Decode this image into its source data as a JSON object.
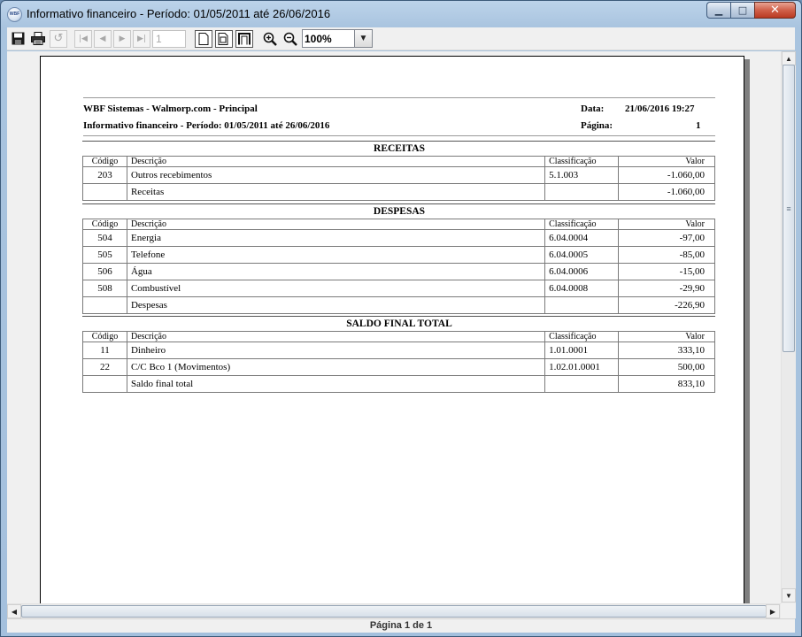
{
  "window": {
    "title": "Informativo financeiro - Período: 01/05/2011 até 26/06/2016",
    "app_icon_text": "WBF"
  },
  "toolbar": {
    "page_input": "1",
    "zoom": "100%",
    "icons": [
      "save-icon",
      "print-icon",
      "refresh-icon",
      "first-page-icon",
      "prev-page-icon",
      "next-page-icon",
      "last-page-icon",
      "single-page-icon",
      "multi-page-icon",
      "page-width-icon",
      "zoom-in-icon",
      "zoom-out-icon"
    ]
  },
  "report": {
    "company": "WBF Sistemas - Walmorp.com - Principal",
    "subtitle": "Informativo financeiro - Período: 01/05/2011 até 26/06/2016",
    "date_label": "Data:",
    "date_value": "21/06/2016 19:27",
    "page_label": "Página:",
    "page_value": "1",
    "columns": {
      "code": "Código",
      "desc": "Descrição",
      "class": "Classificação",
      "value": "Valor"
    },
    "sections": [
      {
        "title": "RECEITAS",
        "rows": [
          {
            "code": "203",
            "desc": "Outros recebimentos",
            "class": "5.1.003",
            "value": "-1.060,00"
          }
        ],
        "total": {
          "desc": "Receitas",
          "value": "-1.060,00"
        }
      },
      {
        "title": "DESPESAS",
        "rows": [
          {
            "code": "504",
            "desc": "Energia",
            "class": "6.04.0004",
            "value": "-97,00"
          },
          {
            "code": "505",
            "desc": "Telefone",
            "class": "6.04.0005",
            "value": "-85,00"
          },
          {
            "code": "506",
            "desc": "Água",
            "class": "6.04.0006",
            "value": "-15,00"
          },
          {
            "code": "508",
            "desc": "Combustível",
            "class": "6.04.0008",
            "value": "-29,90"
          }
        ],
        "total": {
          "desc": "Despesas",
          "value": "-226,90"
        }
      },
      {
        "title": "SALDO FINAL TOTAL",
        "rows": [
          {
            "code": "11",
            "desc": "Dinheiro",
            "class": "1.01.0001",
            "value": "333,10"
          },
          {
            "code": "22",
            "desc": "C/C Bco 1 (Movimentos)",
            "class": "1.02.01.0001",
            "value": "500,00"
          }
        ],
        "total": {
          "desc": "Saldo final total",
          "value": "833,10"
        }
      }
    ]
  },
  "status": {
    "text": "Página 1 de 1"
  }
}
